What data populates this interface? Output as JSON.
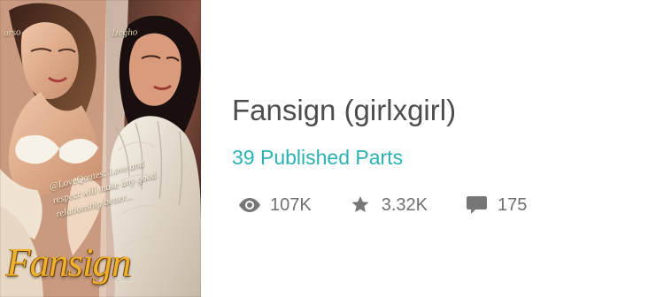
{
  "story": {
    "cover": {
      "top_left_text": "urso",
      "top_right_text": "Izegho",
      "quote": "@LoveQoutes: Love and respect will make any good relationship better...",
      "title": "Fansign"
    },
    "title": "Fansign (girlxgirl)",
    "published_parts": "39 Published Parts",
    "stats": {
      "reads": "107K",
      "votes": "3.32K",
      "comments": "175"
    }
  },
  "icons": {
    "reads": "eye-icon",
    "votes": "star-icon",
    "comments": "comment-icon"
  },
  "colors": {
    "title": "#4d4d4d",
    "published_parts": "#29b2b1",
    "stats": "#777777",
    "cover_title": "#f0b12e"
  }
}
